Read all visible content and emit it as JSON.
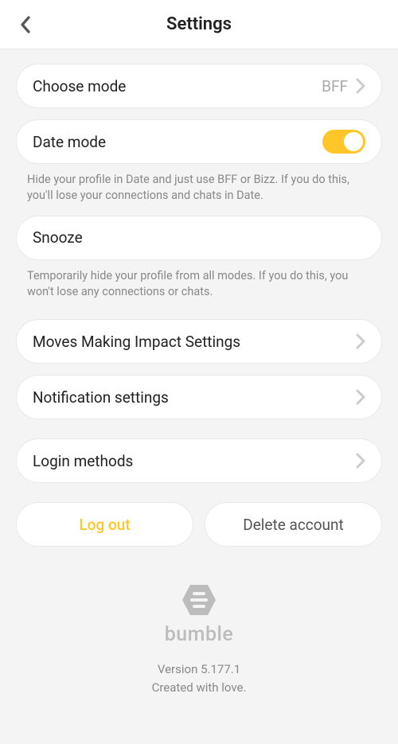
{
  "header": {
    "title": "Settings"
  },
  "rows": {
    "choose_mode": {
      "label": "Choose mode",
      "value": "BFF"
    },
    "date_mode": {
      "label": "Date mode",
      "toggle_on": true
    },
    "date_mode_hint": "Hide your profile in Date and just use BFF or Bizz. If you do this, you'll lose your connections and chats in Date.",
    "snooze": {
      "label": "Snooze"
    },
    "snooze_hint": "Temporarily hide your profile from all modes. If you do this, you won't lose any connections or chats.",
    "moves": {
      "label": "Moves Making Impact Settings"
    },
    "notifications": {
      "label": "Notification settings"
    },
    "login": {
      "label": "Login methods"
    }
  },
  "buttons": {
    "logout": "Log out",
    "delete": "Delete account"
  },
  "footer": {
    "brand": "bumble",
    "version": "Version 5.177.1",
    "tagline": "Created with love."
  }
}
